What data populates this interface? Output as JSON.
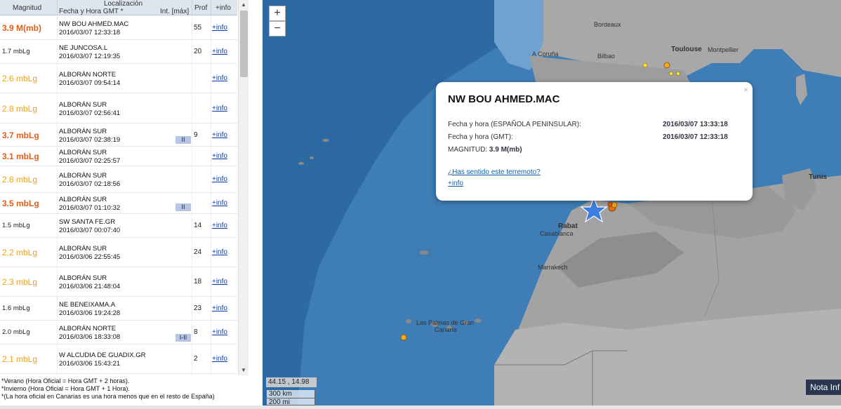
{
  "table": {
    "headers": {
      "magnitud": "Magnitud",
      "localizacion": "Localización",
      "fecha": "Fecha y Hora GMT *",
      "int": "Int. [máx]",
      "prof": "Prof",
      "info": "+info"
    },
    "rows": [
      {
        "mag": "3.9 M(mb)",
        "loc": "NW BOU AHMED.MAC",
        "date": "2016/03/07 12:33:18",
        "int": "",
        "prof": "55",
        "info": "+info",
        "color": "#e0601a"
      },
      {
        "mag": "1.7 mbLg",
        "loc": "NE JUNCOSA.L",
        "date": "2016/03/07 12:19:35",
        "int": "",
        "prof": "20",
        "info": "+info",
        "color": "#222222"
      },
      {
        "mag": "2.6 mbLg",
        "loc": "ALBORÁN NORTE",
        "date": "2016/03/07 09:54:14",
        "int": "",
        "prof": "",
        "info": "+info",
        "color": "#eda21c"
      },
      {
        "mag": "2.8 mbLg",
        "loc": "ALBORÁN SUR",
        "date": "2016/03/07 02:56:41",
        "int": "",
        "prof": "",
        "info": "+info",
        "color": "#eda21c"
      },
      {
        "mag": "3.7 mbLg",
        "loc": "ALBORÁN SUR",
        "date": "2016/03/07 02:38:19",
        "int": "II",
        "prof": "9",
        "info": "+info",
        "color": "#e0601a"
      },
      {
        "mag": "3.1 mbLg",
        "loc": "ALBORÁN SUR",
        "date": "2016/03/07 02:25:57",
        "int": "",
        "prof": "",
        "info": "+info",
        "color": "#e0601a"
      },
      {
        "mag": "2.8 mbLg",
        "loc": "ALBORÁN SUR",
        "date": "2016/03/07 02:18:56",
        "int": "",
        "prof": "",
        "info": "+info",
        "color": "#eda21c"
      },
      {
        "mag": "3.5 mbLg",
        "loc": "ALBORÁN SUR",
        "date": "2016/03/07 01:10:32",
        "int": "II",
        "prof": "",
        "info": "+info",
        "color": "#e0601a"
      },
      {
        "mag": "1.5 mbLg",
        "loc": "SW SANTA FE.GR",
        "date": "2016/03/07 00:07:40",
        "int": "",
        "prof": "14",
        "info": "+info",
        "color": "#222222"
      },
      {
        "mag": "2.2 mbLg",
        "loc": "ALBORÁN SUR",
        "date": "2016/03/06 22:55:45",
        "int": "",
        "prof": "24",
        "info": "+info",
        "color": "#eda21c"
      },
      {
        "mag": "2.3 mbLg",
        "loc": "ALBORÁN SUR",
        "date": "2016/03/06 21:48:04",
        "int": "",
        "prof": "18",
        "info": "+info",
        "color": "#eda21c"
      },
      {
        "mag": "1.6 mbLg",
        "loc": "NE BENEIXAMA.A",
        "date": "2016/03/06 19:24:28",
        "int": "",
        "prof": "23",
        "info": "+info",
        "color": "#222222"
      },
      {
        "mag": "2.0 mbLg",
        "loc": "ALBORÁN NORTE",
        "date": "2016/03/06 18:33:08",
        "int": "I-II",
        "prof": "8",
        "info": "+info",
        "color": "#222222"
      },
      {
        "mag": "2.1 mbLg",
        "loc": "W ALCUDIA DE GUADIX.GR",
        "date": "2016/03/06 15:43:21",
        "int": "",
        "prof": "2",
        "info": "+info",
        "color": "#eda21c"
      }
    ]
  },
  "notes": [
    "*Verano (Hora Oficial = Hora GMT + 2 horas).",
    "*Invierno (Hora Oficial = Hora GMT + 1 Hora).",
    "*(La hora oficial en Canarias es una hora menos que en el resto de España)"
  ],
  "map": {
    "zoom_in": "+",
    "zoom_out": "−",
    "coords": "44.15 , 14.98",
    "scale_km": "300 km",
    "scale_mi": "200 mi",
    "nota": "Nota Inf",
    "cities": {
      "bordeaux": "Bordeaux",
      "toulouse": "Toulouse",
      "montpellier": "Montpellier",
      "coruna": "A Coruña",
      "bilbao": "Bilbao",
      "tunis": "Tunis",
      "rabat": "Rabat",
      "casablanca": "Casablanca",
      "marrakech": "Marrakech",
      "laspalmas": "Las Palmas de Gran",
      "canaria": "Canaria"
    }
  },
  "popup": {
    "title": "NW BOU AHMED.MAC",
    "close": "×",
    "fecha_esp_label": "Fecha y hora (ESPAÑOLA PENINSULAR):",
    "fecha_esp_value": "2016/03/07 13:33:18",
    "fecha_gmt_label": "Fecha y hora (GMT):",
    "fecha_gmt_value": "2016/03/07 12:33:18",
    "magnitud_label": "MAGNITUD:",
    "magnitud_value": "3.9 M(mb)",
    "link_sentido": "¿Has sentido este terremoto?",
    "link_info": "+info"
  }
}
